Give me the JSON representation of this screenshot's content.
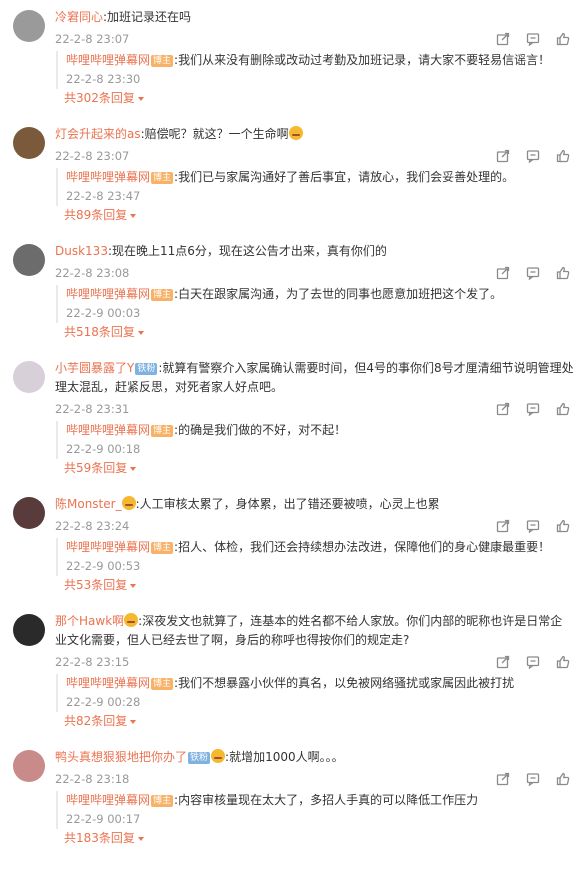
{
  "comments": [
    {
      "user": "冷窘同心",
      "text": ":加班记录还在吗",
      "time": "22-2-8 23:07",
      "reply": {
        "user": "哔哩哔哩弹幕网",
        "badge": "博主",
        "text": ":我们从来没有删除或改动过考勤及加班记录，请大家不要轻易信谣言！",
        "time": "22-2-8 23:30"
      },
      "more": "共302条回复"
    },
    {
      "user": "灯会升起来的as",
      "text": ":赔偿呢？就这？一个生命啊",
      "time": "22-2-8 23:07",
      "reply": {
        "user": "哔哩哔哩弹幕网",
        "badge": "博主",
        "text": ":我们已与家属沟通好了善后事宜，请放心，我们会妥善处理的。",
        "time": "22-2-8 23:47"
      },
      "more": "共89条回复"
    },
    {
      "user": "Dusk133",
      "text": ":现在晚上11点6分，现在这公告才出来，真有你们的",
      "time": "22-2-8 23:08",
      "reply": {
        "user": "哔哩哔哩弹幕网",
        "badge": "博主",
        "text": ":白天在跟家属沟通，为了去世的同事也愿意加班把这个发了。",
        "time": "22-2-9 00:03"
      },
      "more": "共518条回复"
    },
    {
      "user": "小芋圆暴露了Y",
      "badge": "铁粉",
      "text": ":就算有警察介入家属确认需要时间，但4号的事你们8号才厘清细节说明管理处理太混乱，赶紧反思，对死者家人好点吧。",
      "time": "22-2-8 23:31",
      "reply": {
        "user": "哔哩哔哩弹幕网",
        "badge": "博主",
        "text": ":的确是我们做的不好，对不起！",
        "time": "22-2-9 00:18"
      },
      "more": "共59条回复"
    },
    {
      "user": "陈Monster_",
      "text": ":人工审核太累了，身体累，出了错还要被喷，心灵上也累",
      "time": "22-2-8 23:24",
      "reply": {
        "user": "哔哩哔哩弹幕网",
        "badge": "博主",
        "text": ":招人、体检，我们还会持续想办法改进，保障他们的身心健康最重要！",
        "time": "22-2-9 00:53"
      },
      "more": "共53条回复"
    },
    {
      "user": "那个Hawk啊",
      "text": ":深夜发文也就算了，连基本的姓名都不给人家放。你们内部的昵称也许是日常企业文化需要，但人已经去世了啊，身后的称呼也得按你们的规定走?",
      "time": "22-2-8 23:15",
      "reply": {
        "user": "哔哩哔哩弹幕网",
        "badge": "博主",
        "text": ":我们不想暴露小伙伴的真名，以免被网络骚扰或家属因此被打扰",
        "time": "22-2-9 00:28"
      },
      "more": "共82条回复"
    },
    {
      "user": "鸭头真想狠狠地把你办了",
      "badge": "铁粉",
      "text": ":就增加1000人啊。。。",
      "time": "22-2-8 23:18",
      "reply": {
        "user": "哔哩哔哩弹幕网",
        "badge": "博主",
        "text": ":内容审核量现在太大了，多招人手真的可以降低工作压力",
        "time": "22-2-9 00:17"
      },
      "more": "共183条回复"
    }
  ]
}
